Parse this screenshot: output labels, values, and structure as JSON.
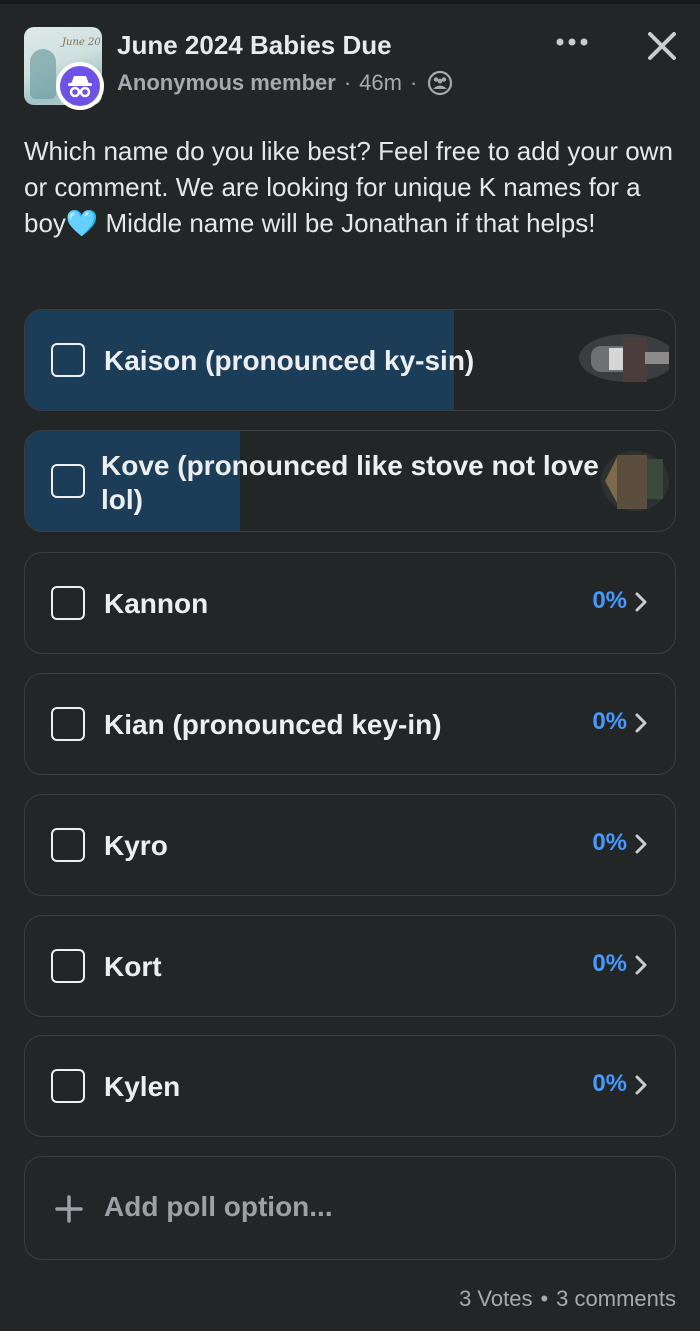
{
  "post": {
    "group_name": "June 2024 Babies Due",
    "author": "Anonymous member",
    "separator": "·",
    "time": "46m",
    "audience_icon": "group-audience-icon",
    "text": "Which name do you like best? Feel free to add your own or comment. We are looking for unique K names for a boy🩵 Middle name will be Jonathan if that helps!"
  },
  "header_actions": {
    "more_icon": "more-dots-icon",
    "close_icon": "close-icon"
  },
  "poll": {
    "options": [
      {
        "label": "Kaison (pronounced ky-sin)",
        "percent": "",
        "fill_fraction": 0.66,
        "has_voters": true
      },
      {
        "label": "Kove (pronounced like stove not love lol)",
        "percent": "",
        "fill_fraction": 0.33,
        "has_voters": true
      },
      {
        "label": "Kannon",
        "percent": "0%",
        "fill_fraction": 0,
        "has_voters": false
      },
      {
        "label": "Kian (pronounced key-in)",
        "percent": "0%",
        "fill_fraction": 0,
        "has_voters": false
      },
      {
        "label": "Kyro",
        "percent": "0%",
        "fill_fraction": 0,
        "has_voters": false
      },
      {
        "label": "Kort",
        "percent": "0%",
        "fill_fraction": 0,
        "has_voters": false
      },
      {
        "label": "Kylen",
        "percent": "0%",
        "fill_fraction": 0,
        "has_voters": false
      }
    ],
    "add_option_label": "Add poll option..."
  },
  "footer": {
    "votes": "3 Votes",
    "bullet": "•",
    "comments": "3 comments"
  },
  "colors": {
    "background": "#232626",
    "vote_fill": "#1c3d57",
    "percent_blue": "#4599ff",
    "anon_badge": "#6d52e6"
  }
}
